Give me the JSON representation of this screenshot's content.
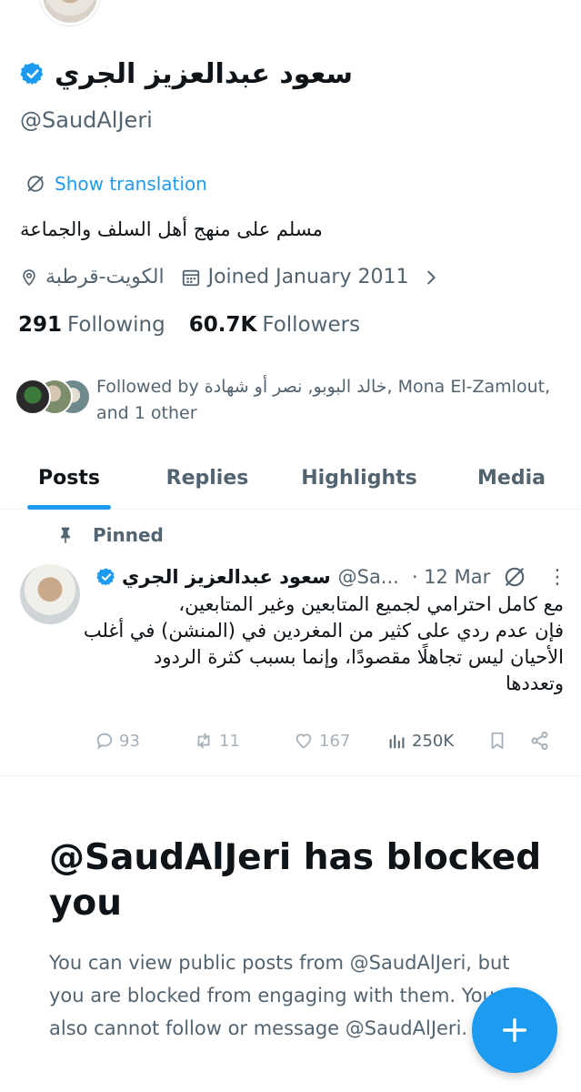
{
  "profile": {
    "display_name": "سعود عبدالعزيز الجري",
    "handle": "@SaudAlJeri",
    "show_translation": "Show translation",
    "bio": "مسلم على منهج أهل السلف والجماعة",
    "location": "الكويت-قرطبة",
    "joined": "Joined January 2011",
    "following_count": "291",
    "following_label": "Following",
    "followers_count": "60.7K",
    "followers_label": "Followers",
    "followed_by_line1": "Followed by خالد البوبو, نصر أو شهادة, Mona El-Zamlout,",
    "followed_by_line2": "and 1 other"
  },
  "tabs": [
    {
      "label": "Posts",
      "active": true
    },
    {
      "label": "Replies",
      "active": false
    },
    {
      "label": "Highlights",
      "active": false
    },
    {
      "label": "Media",
      "active": false
    }
  ],
  "pinned_post": {
    "pinned_label": "Pinned",
    "author_name": "سعود عبدالعزيز الجري",
    "author_handle": "@Sa...",
    "date": "· 12 Mar",
    "text_lines": [
      "مع كامل احترامي لجميع المتابعين وغير المتابعين،",
      "فإن عدم ردي على كثير من المغردين في (المنشن) في أغلب",
      "الأحيان ليس تجاهلًا مقصودًا، وإنما بسبب كثرة الردود",
      "وتعددها"
    ],
    "replies": "93",
    "reposts": "11",
    "likes": "167",
    "views": "250K"
  },
  "blocked": {
    "title": "@SaudAlJeri has blocked you",
    "description": "You can view public posts from @SaudAlJeri, but you are blocked from engaging with them. You also cannot follow or message @SaudAlJeri."
  },
  "icons": {
    "verified": "verified-badge-icon",
    "translate": "translate-icon",
    "location": "location-pin-icon",
    "calendar": "calendar-icon",
    "chevron": "chevron-right-icon",
    "pin": "pin-icon",
    "reply": "reply-icon",
    "repost": "repost-icon",
    "like": "heart-icon",
    "views": "views-icon",
    "bookmark": "bookmark-icon",
    "share": "share-icon",
    "compose": "plus-icon"
  },
  "colors": {
    "accent": "#1d9bf0",
    "text": "#0f1419",
    "muted": "#536471"
  }
}
